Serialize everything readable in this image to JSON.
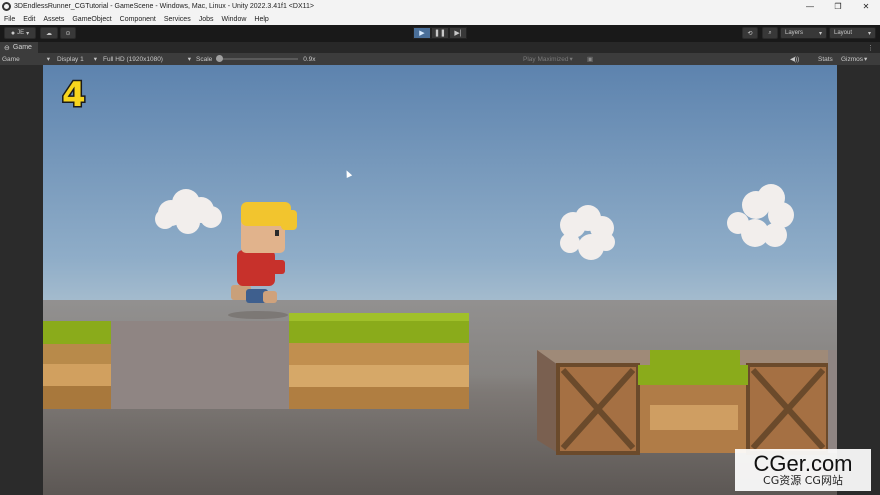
{
  "window": {
    "title": "3DEndlessRunner_CGTutorial - GameScene - Windows, Mac, Linux - Unity 2022.3.41f1 <DX11>",
    "controls": [
      "—",
      "❐",
      "✕"
    ]
  },
  "menu": [
    "File",
    "Edit",
    "Assets",
    "GameObject",
    "Component",
    "Services",
    "Jobs",
    "Window",
    "Help"
  ],
  "toolbar": {
    "account_label": "JE",
    "layers_label": "Layers",
    "layout_label": "Layout",
    "play_active": true
  },
  "tab": {
    "label": "Game"
  },
  "gamebar": {
    "view_mode": "Game",
    "display": "Display 1",
    "resolution": "Full HD (1920x1080)",
    "scale_label": "Scale",
    "scale_value": "0.9x",
    "play_mode": "Play Maximized",
    "stats_label": "Stats",
    "gizmos_label": "Gizmos"
  },
  "game": {
    "score": "4"
  },
  "watermark": {
    "main": "CGer.com",
    "sub": "CG资源 CG网站"
  },
  "colors": {
    "play_accent": "#4a6f99",
    "score_yellow": "#f7d51d",
    "sky_top": "#5f85b0",
    "sky_horizon": "#c9d4d8"
  }
}
